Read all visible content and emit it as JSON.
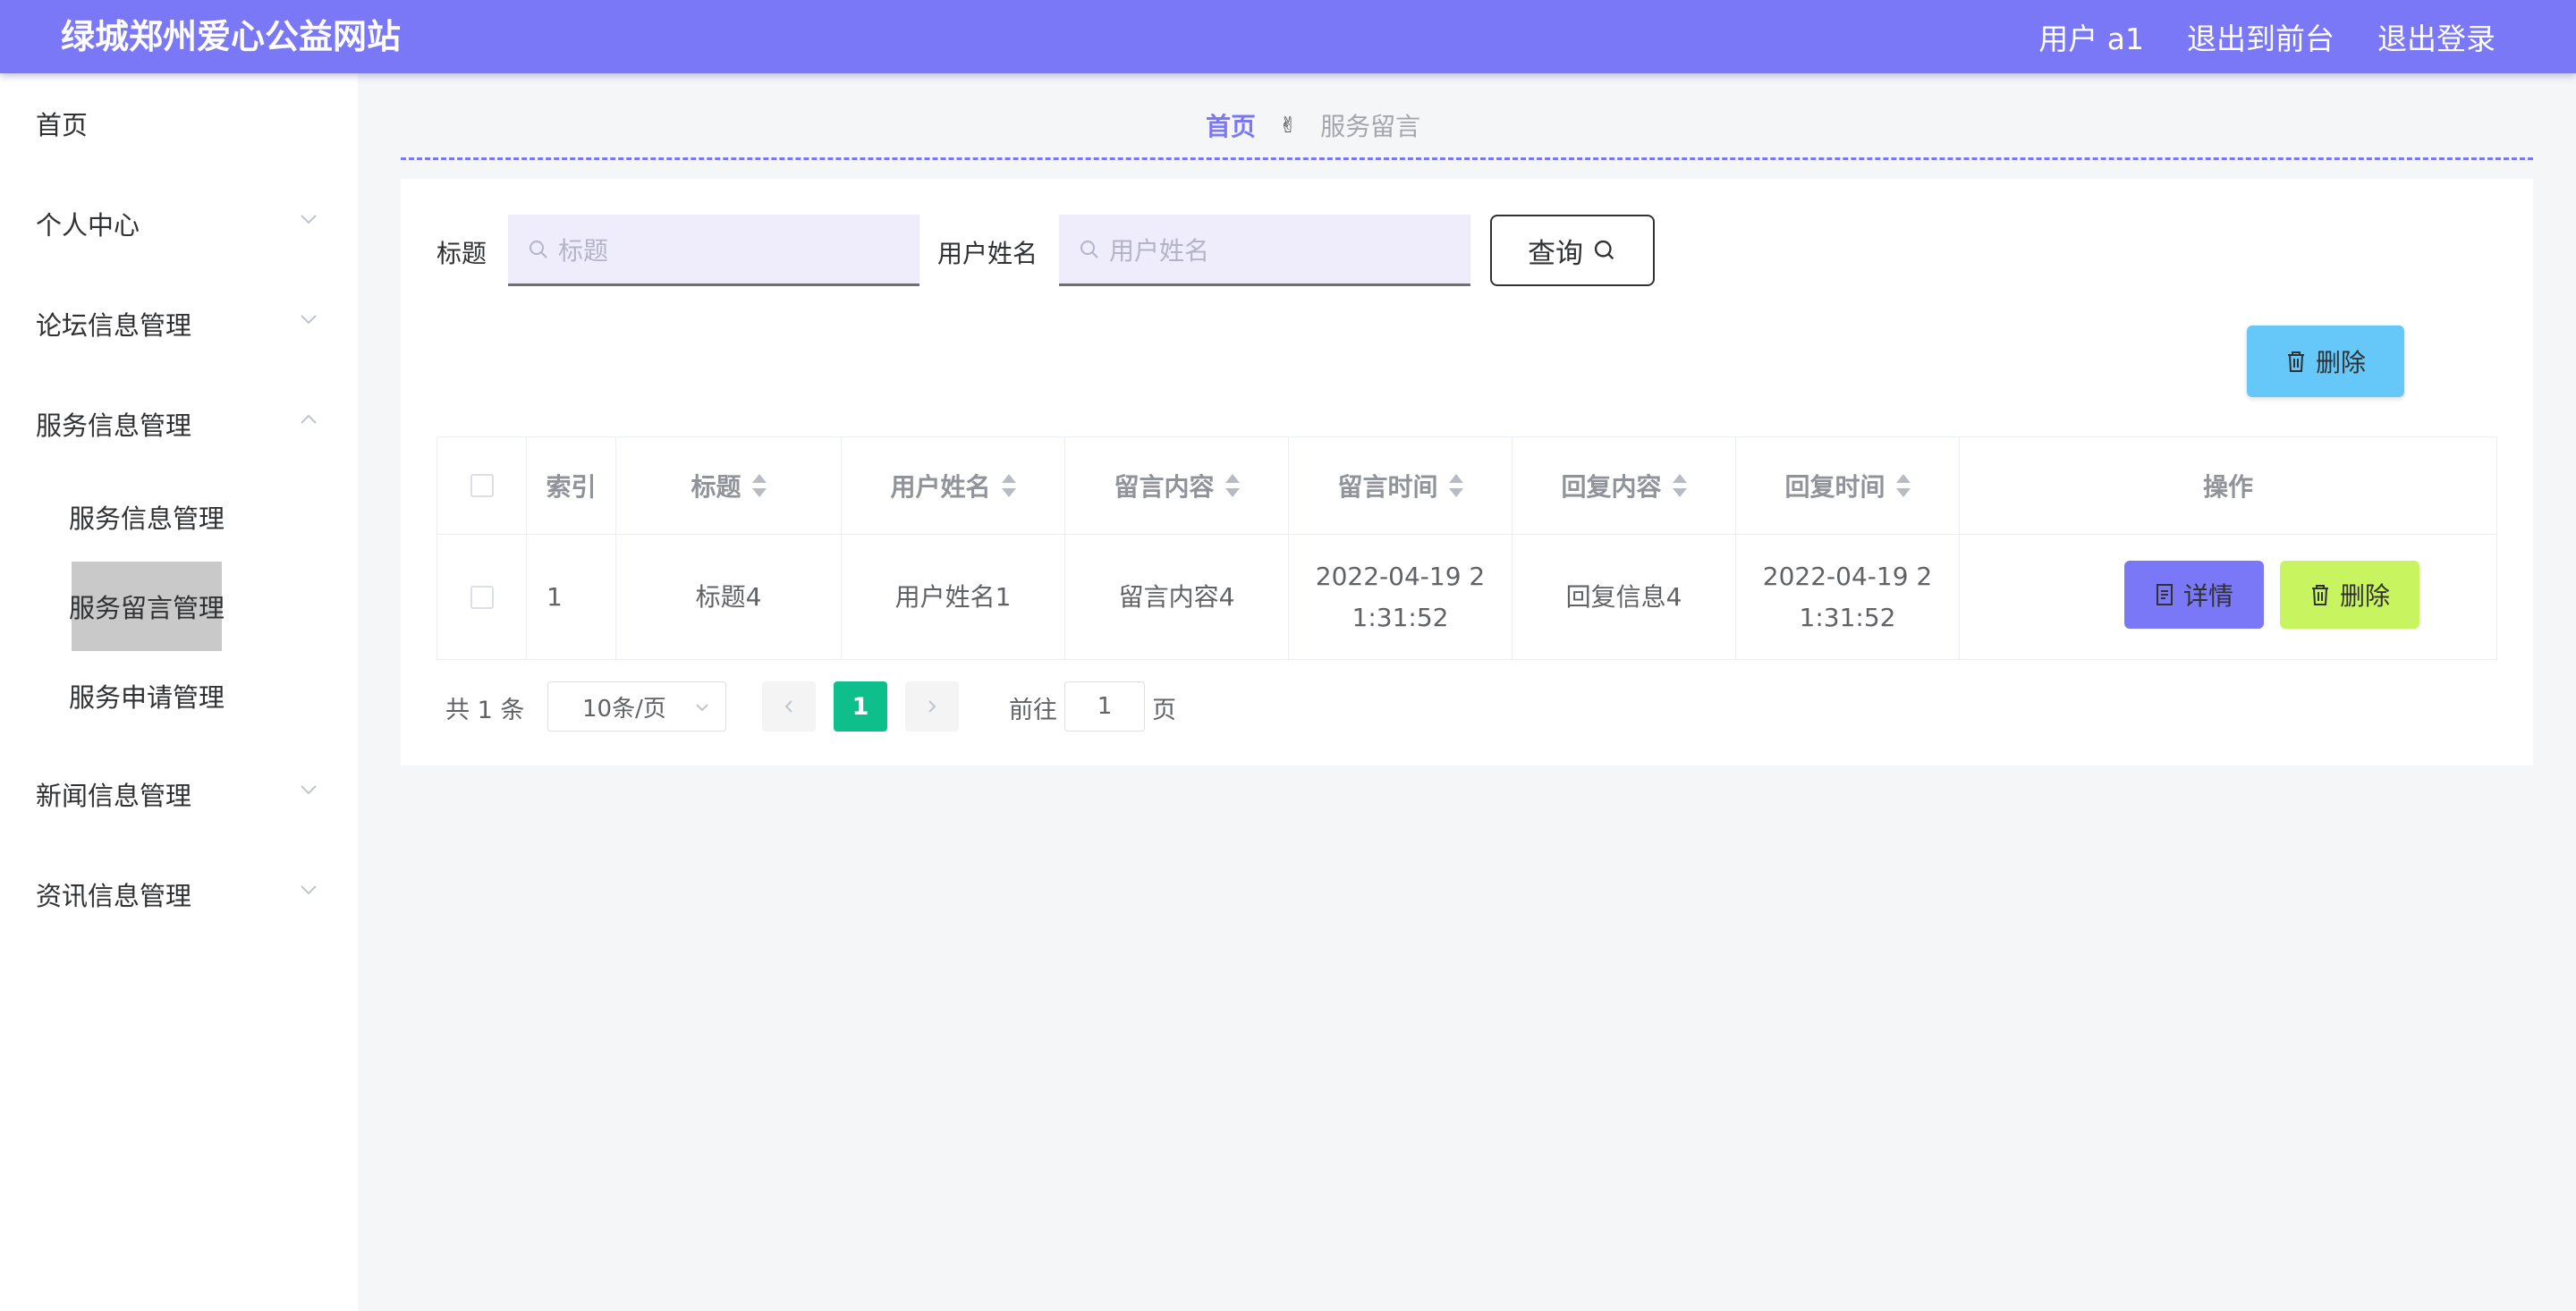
{
  "header": {
    "site_title": "绿城郑州爱心公益网站",
    "user_label": "用户 a1",
    "back_to_front": "退出到前台",
    "logout": "退出登录",
    "bg_color": "#7a78f7"
  },
  "sidebar": {
    "items": [
      {
        "label": "首页"
      },
      {
        "label": "个人中心"
      },
      {
        "label": "论坛信息管理"
      },
      {
        "label": "服务信息管理"
      },
      {
        "label": "新闻信息管理"
      },
      {
        "label": "资讯信息管理"
      }
    ],
    "sub_items": [
      {
        "label": "服务信息管理"
      },
      {
        "label": "服务留言管理",
        "active": true
      },
      {
        "label": "服务申请管理"
      }
    ]
  },
  "breadcrumb": {
    "home": "首页",
    "separator_icon": "✌",
    "current": "服务留言"
  },
  "search": {
    "title_label": "标题",
    "title_placeholder": "标题",
    "username_label": "用户姓名",
    "username_placeholder": "用户姓名",
    "query_button": "查询"
  },
  "toolbar": {
    "delete_label": "删除"
  },
  "table": {
    "columns": [
      "索引",
      "标题",
      "用户姓名",
      "留言内容",
      "留言时间",
      "回复内容",
      "回复时间",
      "操作"
    ],
    "rows": [
      {
        "index": "1",
        "title": "标题4",
        "username": "用户姓名1",
        "content": "留言内容4",
        "msg_time": "2022-04-19 21:31:52",
        "reply": "回复信息4",
        "reply_time": "2022-04-19 21:31:52",
        "detail_label": "详情",
        "delete_label": "删除"
      }
    ]
  },
  "pagination": {
    "total": "共 1 条",
    "page_size": "10条/页",
    "current_page": "1",
    "goto_prefix": "前往",
    "goto_value": "1",
    "goto_suffix": "页"
  }
}
